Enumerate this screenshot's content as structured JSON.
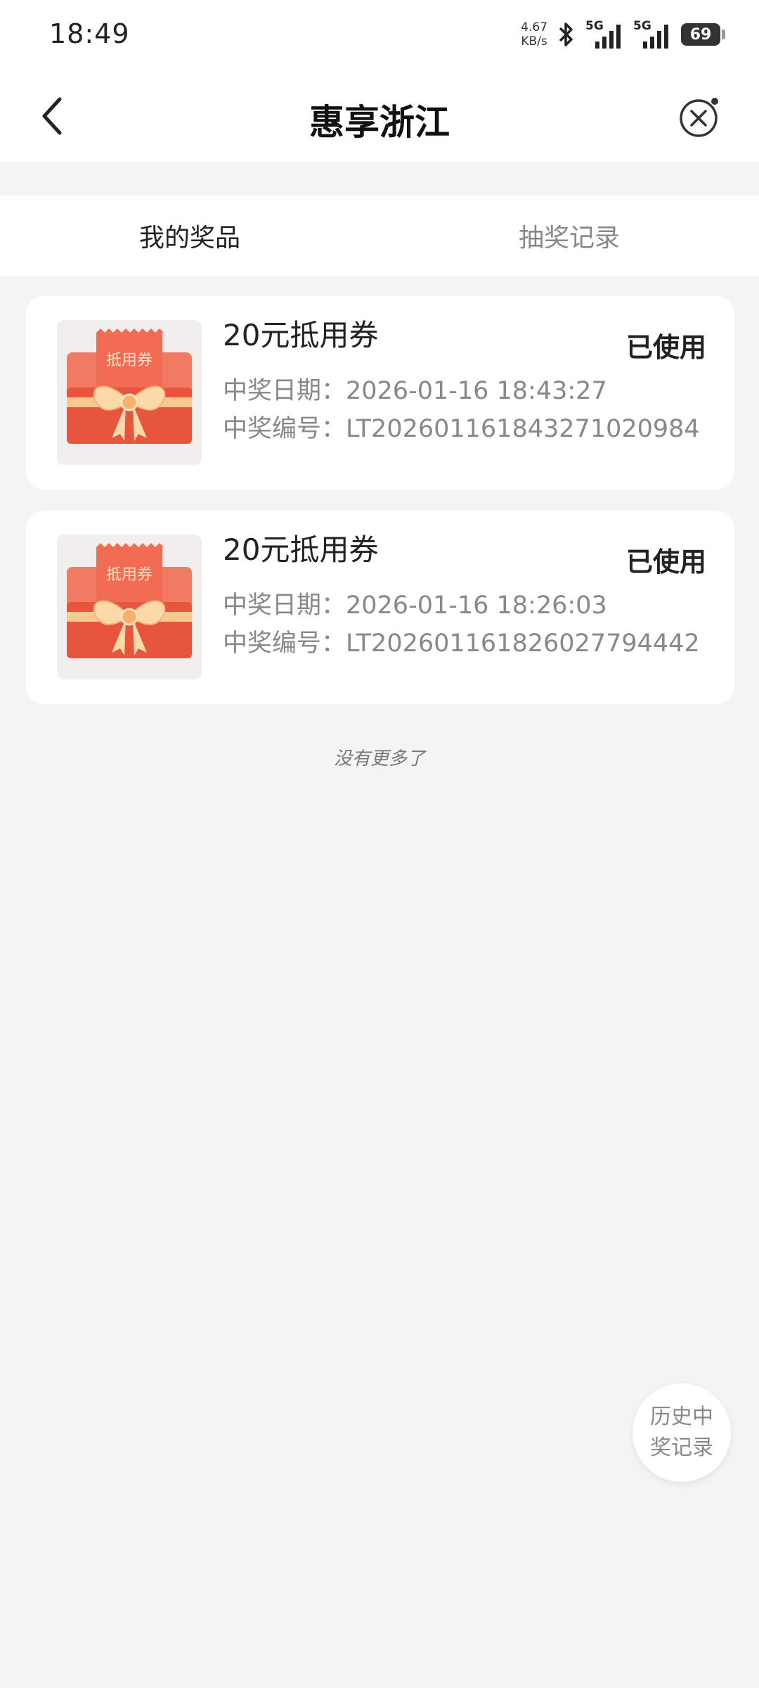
{
  "status_bar": {
    "time": "18:49",
    "net_speed_value": "4.67",
    "net_speed_unit": "KB/s",
    "signal1_label": "5G",
    "signal2_label": "5G",
    "battery": "69"
  },
  "header": {
    "title": "惠享浙江",
    "back_icon": "chevron-left-icon",
    "close_icon": "close-circle-icon"
  },
  "tabs": [
    {
      "label": "我的奖品",
      "active": true
    },
    {
      "label": "抽奖记录",
      "active": false
    }
  ],
  "prizes": [
    {
      "name": "20元抵用券",
      "status": "已使用",
      "date_line": "中奖日期：2026-01-16 18:43:27",
      "number_line": "中奖编号：LT20260116184327102098​4",
      "thumb_label": "抵用券"
    },
    {
      "name": "20元抵用券",
      "status": "已使用",
      "date_line": "中奖日期：2026-01-16 18:26:03",
      "number_line": "中奖编号：LT20260116182602779444​2",
      "thumb_label": "抵用券"
    }
  ],
  "list_end_text": "没有更多了",
  "history_button_label": "历史中奖记录",
  "colors": {
    "accent_red": "#e8553f",
    "ribbon": "#f7c98f"
  }
}
